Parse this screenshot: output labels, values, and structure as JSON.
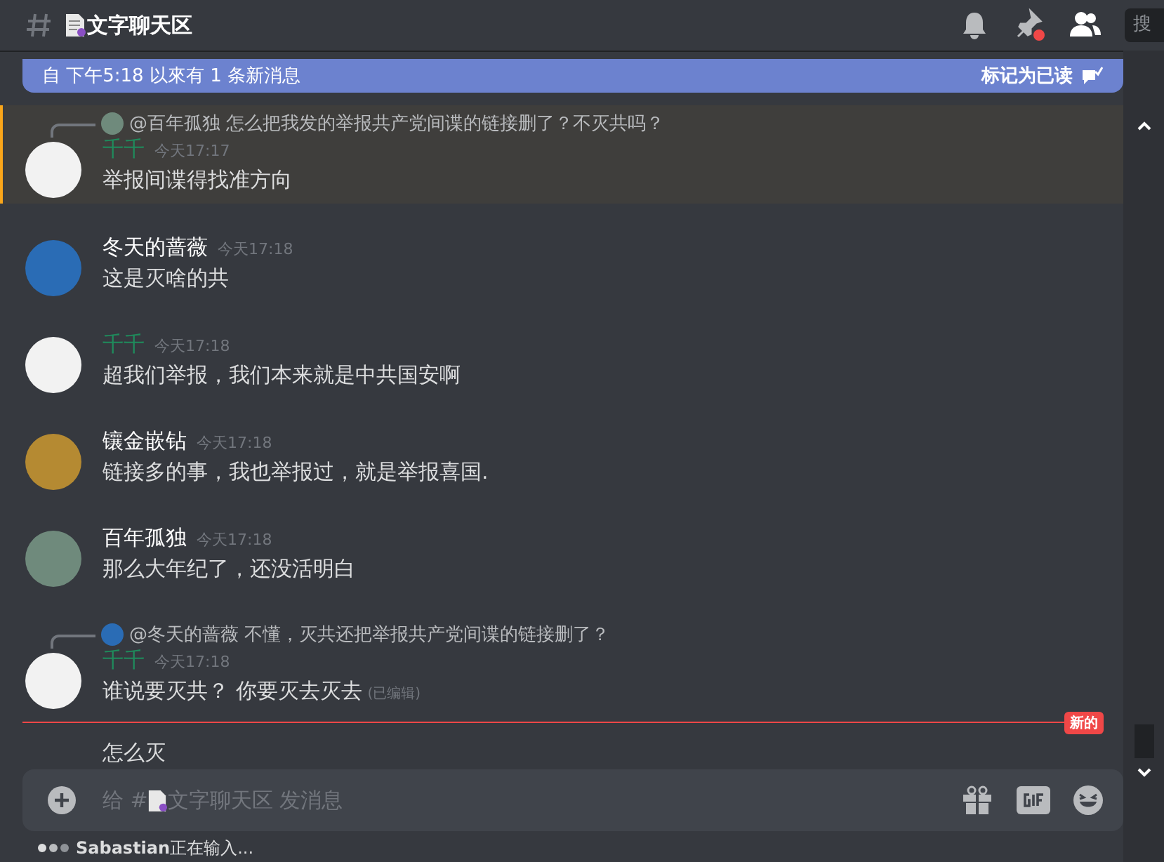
{
  "header": {
    "channel": "文字聊天区",
    "search_placeholder": "搜",
    "pins_unread": true
  },
  "banner": {
    "text": "自 下午5:18 以來有 1 条新消息",
    "action": "标记为已读"
  },
  "messages": [
    {
      "kind": "full",
      "highlighted": true,
      "reply": {
        "avatar": {
          "color": "#6f8a7c"
        },
        "mention": "@百年孤独",
        "text": "怎么把我发的举报共产党间谍的链接删了？不灭共吗？"
      },
      "avatar": {
        "color": "#f2f2f2"
      },
      "author": {
        "name": "千千",
        "color": "#1f8b5c"
      },
      "time": "今天17:17",
      "text": "举报间谍得找准方向"
    },
    {
      "kind": "full",
      "highlighted": false,
      "avatar": {
        "color": "#2a6cb5"
      },
      "author": {
        "name": "冬天的蔷薇",
        "color": "#ffffff"
      },
      "time": "今天17:18",
      "text": "这是灭啥的共"
    },
    {
      "kind": "full",
      "highlighted": false,
      "avatar": {
        "color": "#f2f2f2"
      },
      "author": {
        "name": "千千",
        "color": "#1f8b5c"
      },
      "time": "今天17:18",
      "text": "超我们举报，我们本来就是中共国安啊"
    },
    {
      "kind": "full",
      "highlighted": false,
      "avatar": {
        "color": "#b58a32"
      },
      "author": {
        "name": "镶金嵌钻",
        "color": "#ffffff"
      },
      "time": "今天17:18",
      "text": "链接多的事，我也举报过，就是举报喜国."
    },
    {
      "kind": "full",
      "highlighted": false,
      "avatar": {
        "color": "#6f8a7c"
      },
      "author": {
        "name": "百年孤独",
        "color": "#ffffff"
      },
      "time": "今天17:18",
      "text": "那么大年纪了，还没活明白"
    },
    {
      "kind": "full",
      "highlighted": false,
      "reply": {
        "avatar": {
          "color": "#2a6cb5"
        },
        "mention": "@冬天的蔷薇",
        "text": "不懂，灭共还把举报共产党间谍的链接删了？"
      },
      "avatar": {
        "color": "#f2f2f2"
      },
      "author": {
        "name": "千千",
        "color": "#1f8b5c"
      },
      "time": "今天17:18",
      "text": "谁说要灭共？ 你要灭去灭去",
      "edited": "(已编辑)"
    },
    {
      "kind": "new_divider",
      "label": "新的"
    },
    {
      "kind": "continuation",
      "text": "怎么灭"
    }
  ],
  "composer": {
    "placeholder_before": "给 #",
    "placeholder_after": "文字聊天区 发消息"
  },
  "typing": "**Sabastian**正在输入..."
}
